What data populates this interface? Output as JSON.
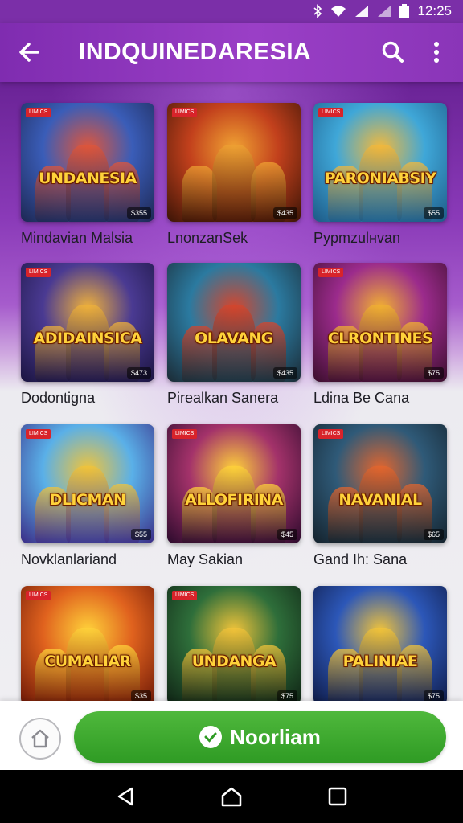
{
  "status_bar": {
    "time": "12:25"
  },
  "app_bar": {
    "title": "INDQUINEDARESIA"
  },
  "games": [
    {
      "title": "Mindavian Malsia",
      "logo": "UNDANESIA",
      "tag": "LIMICS",
      "meta": "$355",
      "colors": [
        "#3a5db8",
        "#e0563a",
        "#1d2752"
      ]
    },
    {
      "title": "LnonzanSek",
      "logo": "",
      "tag": "LIMICS",
      "meta": "$435",
      "colors": [
        "#c2401c",
        "#f0a233",
        "#3a1406"
      ]
    },
    {
      "title": "Pypmzulнvan",
      "logo": "PARONIABSIY",
      "tag": "LIMICS",
      "meta": "$55",
      "colors": [
        "#3fa7d8",
        "#f4b93b",
        "#1d5a86"
      ]
    },
    {
      "title": "Dodontigna",
      "logo": "ADIDAINSICA",
      "tag": "LIMICS",
      "meta": "$473",
      "colors": [
        "#4a3a92",
        "#f0b23b",
        "#1b1440"
      ]
    },
    {
      "title": "Pirealkan Sanera",
      "logo": "OLAVANG",
      "tag": "",
      "meta": "$435",
      "colors": [
        "#2b7aa0",
        "#d5462d",
        "#1b2a34"
      ]
    },
    {
      "title": "Ldina Be Cana",
      "logo": "CLRONTINES",
      "tag": "LIMICS",
      "meta": "$75",
      "colors": [
        "#9b2b8c",
        "#f2b132",
        "#3b0e2c"
      ]
    },
    {
      "title": "Novklanlariand",
      "logo": "DLICMAN",
      "tag": "LIMICS",
      "meta": "$55",
      "colors": [
        "#5ab0e8",
        "#f1c43a",
        "#3a2b86"
      ]
    },
    {
      "title": "May Sakian",
      "logo": "ALLOFIRINA",
      "tag": "LIMICS",
      "meta": "$45",
      "colors": [
        "#a3326a",
        "#ffd23a",
        "#2b0a2c"
      ]
    },
    {
      "title": "Gand Ih: Sana",
      "logo": "NAVANIAL",
      "tag": "LIMICS",
      "meta": "$65",
      "colors": [
        "#2f5a78",
        "#e3662e",
        "#14222c"
      ]
    },
    {
      "title": "",
      "logo": "CUMALIAR",
      "tag": "LIMICS",
      "meta": "$35",
      "colors": [
        "#e0621e",
        "#ffd23a",
        "#6a1606"
      ]
    },
    {
      "title": "",
      "logo": "UNDANGA",
      "tag": "LIMICS",
      "meta": "$75",
      "colors": [
        "#2e6e3a",
        "#f2c43a",
        "#0f2214"
      ]
    },
    {
      "title": "",
      "logo": "PALINIAE",
      "tag": "",
      "meta": "$75",
      "colors": [
        "#2c57b8",
        "#f2c43a",
        "#0f1a44"
      ]
    }
  ],
  "bottom_bar": {
    "main_button_label": "Noorliam"
  }
}
